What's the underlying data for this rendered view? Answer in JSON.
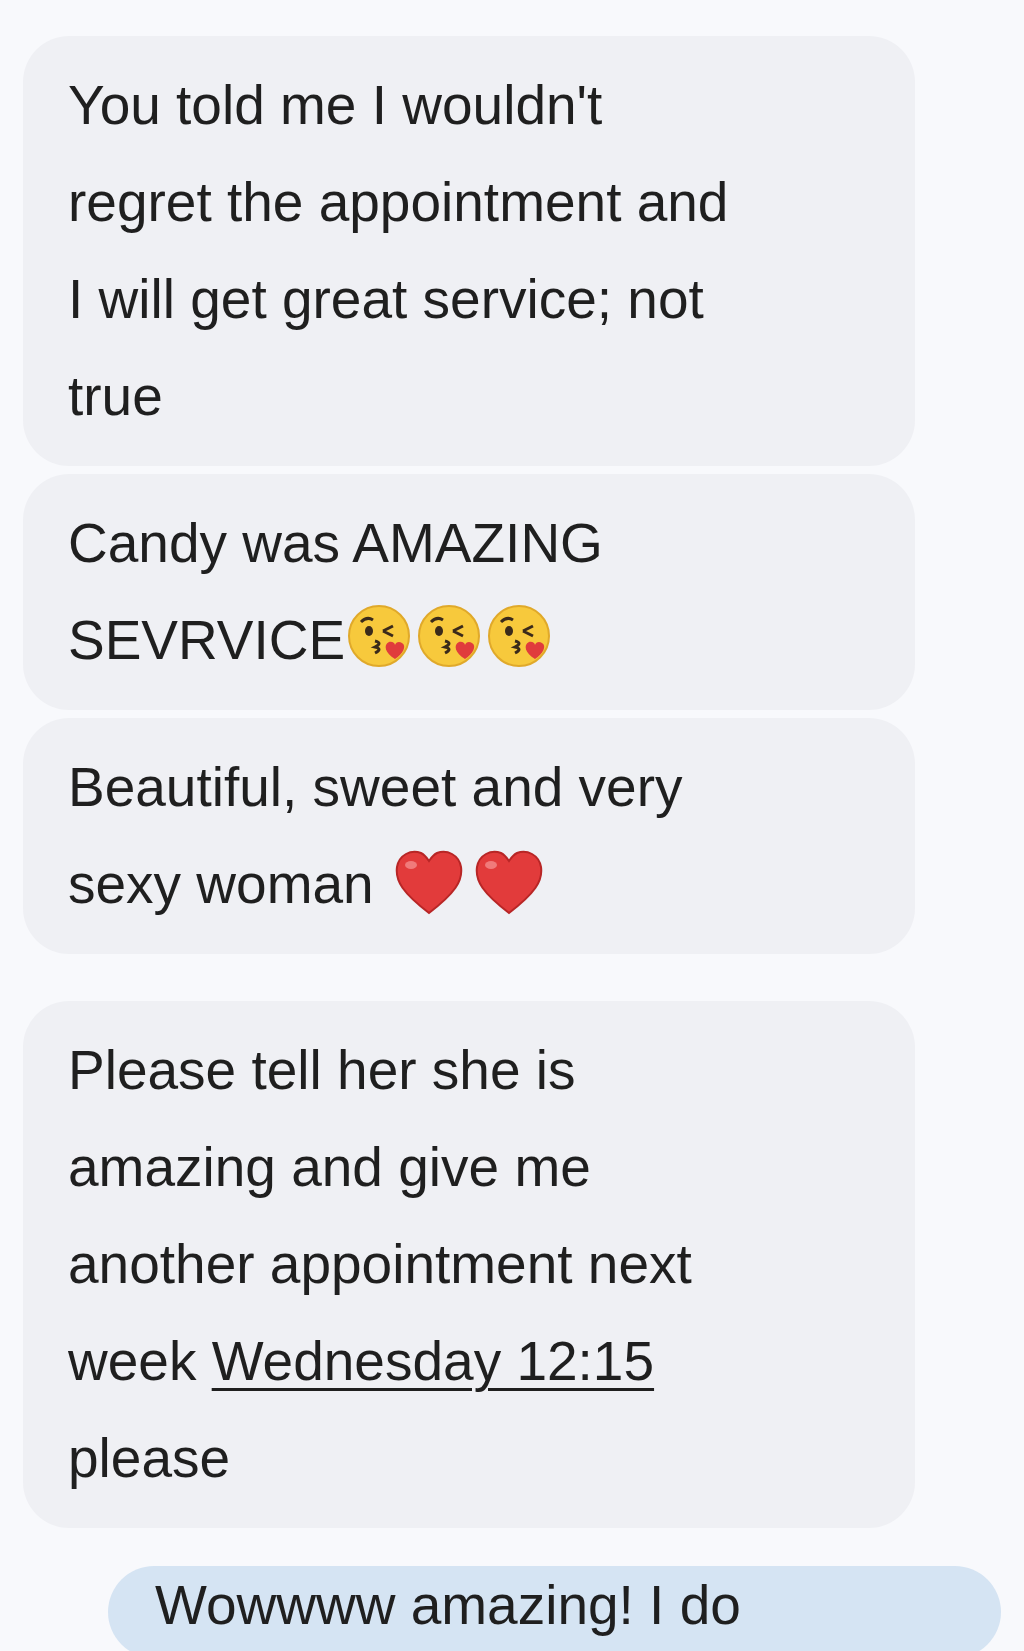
{
  "messages": [
    {
      "kind": "received",
      "lines": [
        [
          {
            "kind": "text",
            "text": "You told me I wouldn't"
          }
        ],
        [
          {
            "kind": "text",
            "text": "regret the appointment and"
          }
        ],
        [
          {
            "kind": "text",
            "text": "I will get great service; not"
          }
        ],
        [
          {
            "kind": "text",
            "text": "true"
          }
        ]
      ]
    },
    {
      "kind": "received",
      "lines": [
        [
          {
            "kind": "text",
            "text": "Candy was AMAZING"
          }
        ],
        [
          {
            "kind": "text",
            "text": "SEVRVICE"
          },
          {
            "kind": "kiss_emoji"
          },
          {
            "kind": "kiss_emoji"
          },
          {
            "kind": "kiss_emoji"
          }
        ]
      ]
    },
    {
      "kind": "received",
      "lines": [
        [
          {
            "kind": "text",
            "text": "Beautiful, sweet and very"
          }
        ],
        [
          {
            "kind": "text",
            "text": "sexy woman "
          },
          {
            "kind": "heart_emoji"
          },
          {
            "kind": "heart_emoji"
          }
        ]
      ]
    },
    {
      "kind": "received",
      "lines": [
        [
          {
            "kind": "text",
            "text": "Please tell her she is"
          }
        ],
        [
          {
            "kind": "text",
            "text": "amazing and give me"
          }
        ],
        [
          {
            "kind": "text",
            "text": "another appointment next"
          }
        ],
        [
          {
            "kind": "text",
            "text": "week "
          },
          {
            "kind": "link",
            "text": "Wednesday 12:15"
          }
        ],
        [
          {
            "kind": "text",
            "text": "please"
          }
        ]
      ]
    },
    {
      "kind": "sent",
      "lines": [
        [
          {
            "kind": "text",
            "text": "Wowwww amazing! I do"
          }
        ]
      ]
    }
  ]
}
